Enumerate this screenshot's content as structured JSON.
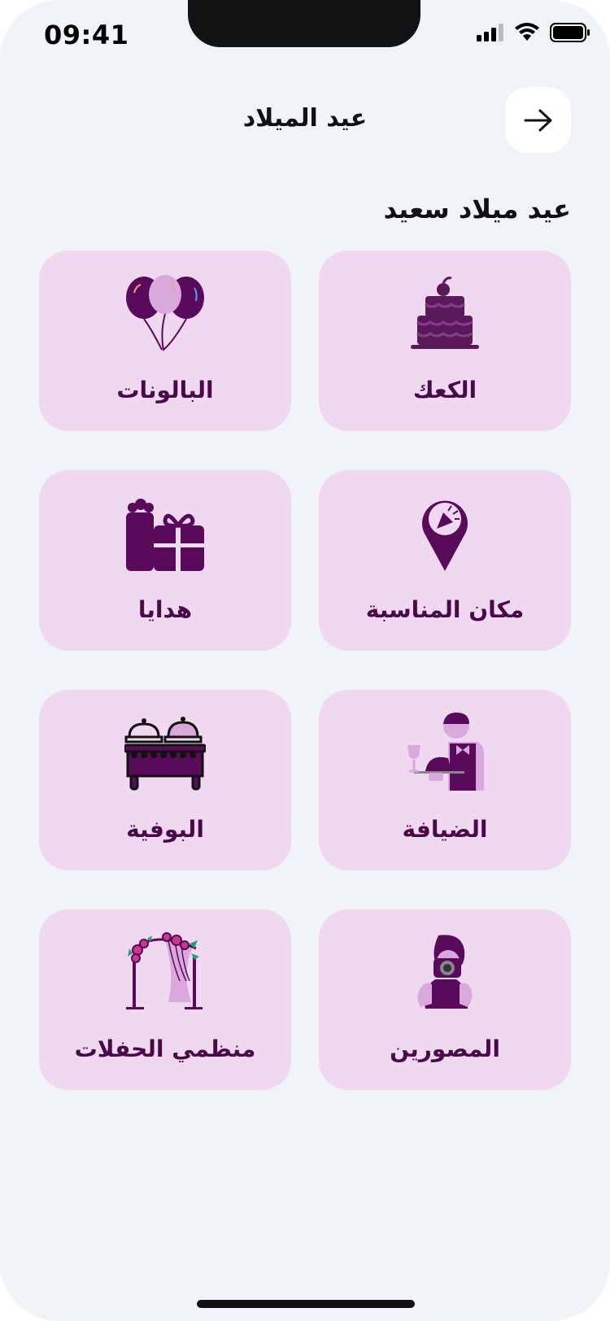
{
  "status_bar": {
    "time": "09:41"
  },
  "header": {
    "title": "عيد الميلاد",
    "back_icon": "arrow-right-icon"
  },
  "section": {
    "title": "عيد ميلاد سعيد"
  },
  "colors": {
    "card_bg": "#f0d8f0",
    "accent": "#5a0a5a",
    "light_accent": "#d9a8dc",
    "page_bg": "#f0f3f8"
  },
  "categories": [
    {
      "label": "الكعك",
      "icon": "cake-icon"
    },
    {
      "label": "البالونات",
      "icon": "balloons-icon"
    },
    {
      "label": "مكان المناسبة",
      "icon": "location-pin-icon"
    },
    {
      "label": "هدايا",
      "icon": "gifts-icon"
    },
    {
      "label": "الضيافة",
      "icon": "waiter-icon"
    },
    {
      "label": "البوفية",
      "icon": "buffet-icon"
    },
    {
      "label": "المصورين",
      "icon": "photographer-icon"
    },
    {
      "label": "منظمي الحفلات",
      "icon": "party-planner-icon"
    }
  ]
}
